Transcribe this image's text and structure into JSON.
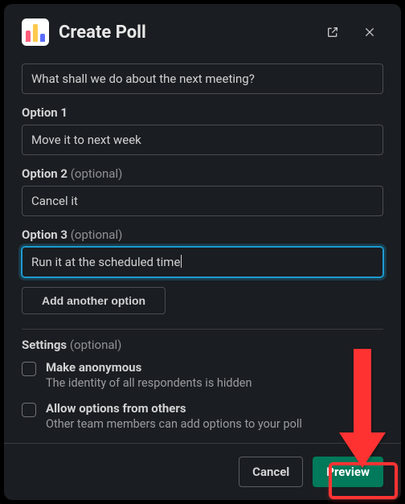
{
  "header": {
    "title": "Create Poll"
  },
  "question": {
    "value": "What shall we do about the next meeting?"
  },
  "options": [
    {
      "label": "Option 1",
      "optional": "",
      "value": "Move it to next week",
      "focused": false
    },
    {
      "label": "Option 2",
      "optional": "(optional)",
      "value": "Cancel it",
      "focused": false
    },
    {
      "label": "Option 3",
      "optional": "(optional)",
      "value": "Run it at the scheduled time",
      "focused": true
    }
  ],
  "add_option_label": "Add another option",
  "settings": {
    "head_label": "Settings",
    "head_optional": "(optional)",
    "items": [
      {
        "title": "Make anonymous",
        "desc": "The identity of all respondents is hidden"
      },
      {
        "title": "Allow options from others",
        "desc": "Other team members can add options to your poll"
      }
    ]
  },
  "footer": {
    "cancel": "Cancel",
    "preview": "Preview"
  }
}
